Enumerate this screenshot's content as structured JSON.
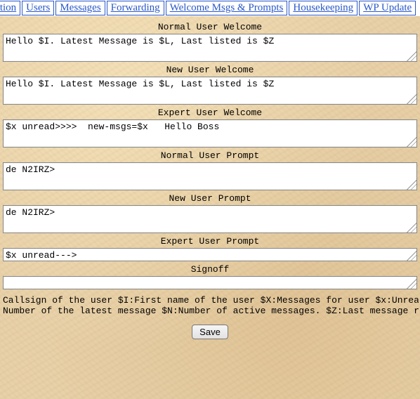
{
  "tabs": [
    {
      "label": "iration"
    },
    {
      "label": "Users"
    },
    {
      "label": "Messages"
    },
    {
      "label": "Forwarding"
    },
    {
      "label": "Welcome Msgs & Prompts"
    },
    {
      "label": "Housekeeping"
    },
    {
      "label": "WP Update"
    }
  ],
  "sections": {
    "normal_user_welcome": {
      "label": "Normal User Welcome",
      "value": "Hello $I. Latest Message is $L, Last listed is $Z"
    },
    "new_user_welcome": {
      "label": "New User Welcome",
      "value": "Hello $I. Latest Message is $L, Last listed is $Z"
    },
    "expert_user_welcome": {
      "label": "Expert User Welcome",
      "value": "$x unread>>>>  new-msgs=$x   Hello Boss"
    },
    "normal_user_prompt": {
      "label": "Normal User Prompt",
      "value": "de N2IRZ>"
    },
    "new_user_prompt": {
      "label": "New User Prompt",
      "value": "de N2IRZ>"
    },
    "expert_user_prompt": {
      "label": "Expert User Prompt",
      "value": "$x unread--->"
    },
    "signoff": {
      "label": "Signoff",
      "value": ""
    }
  },
  "help": {
    "line1": "Callsign of the user  $I:First name of the user $X:Messages for user $x:Unread message",
    "line2": "Number of the latest message $N:Number of active messages. $Z:Last message read by use"
  },
  "buttons": {
    "save": "Save"
  }
}
